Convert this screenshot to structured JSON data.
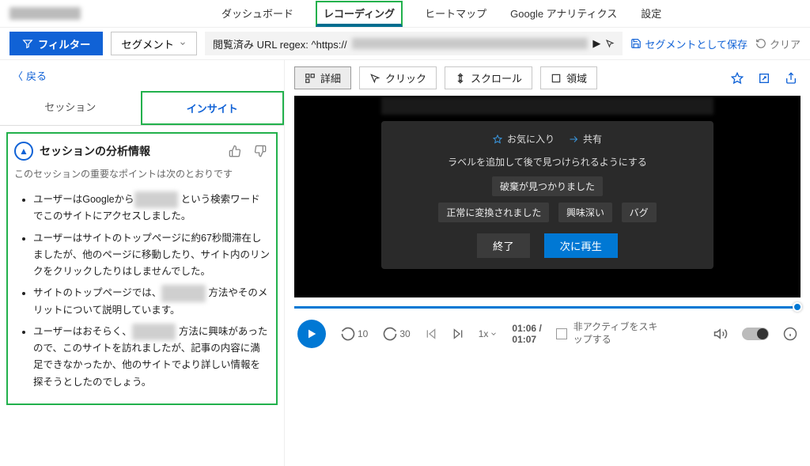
{
  "topnav": {
    "tabs": [
      "ダッシュボード",
      "レコーディング",
      "ヒートマップ",
      "Google アナリティクス",
      "設定"
    ],
    "active_index": 1
  },
  "filterbar": {
    "filter_btn": "フィルター",
    "segment_btn": "セグメント",
    "url_prefix": "閲覧済み URL regex: ^https://",
    "save_segment": "セグメントとして保存",
    "clear": "クリア"
  },
  "left": {
    "back": "戻る",
    "tabs": {
      "session": "セッション",
      "insight": "インサイト"
    },
    "insight": {
      "title": "セッションの分析情報",
      "subtitle": "このセッションの重要なポイントは次のとおりです",
      "items_parts": [
        [
          "ユーザーはGoogleから",
          "BLUR",
          "という検索ワードでこのサイトにアクセスしました。"
        ],
        [
          "ユーザーはサイトのトップページに約67秒間滞在しましたが、他のページに移動したり、サイト内のリンクをクリックしたりはしませんでした。"
        ],
        [
          "サイトのトップページでは、",
          "BLUR",
          "方法やそのメリットについて説明しています。"
        ],
        [
          "ユーザーはおそらく、",
          "BLUR",
          "方法に興味があったので、このサイトを訪れましたが、記事の内容に満足できなかったか、他のサイトでより詳しい情報を探そうとしたのでしょう。"
        ]
      ]
    }
  },
  "right": {
    "toolbar": {
      "detail": "詳細",
      "click": "クリック",
      "scroll": "スクロール",
      "area": "領域"
    },
    "player": {
      "favorite": "お気に入り",
      "share": "共有",
      "label_hint": "ラベルを追加して後で見つけられるようにする",
      "tag1": "破棄が見つかりました",
      "tag2": "正常に変換されました",
      "tag3": "興味深い",
      "tag4": "バグ",
      "end": "終了",
      "next": "次に再生"
    },
    "controls": {
      "rewind": "10",
      "forward": "30",
      "speed": "1x",
      "time_current": "01:06",
      "time_total": "01:07",
      "skip_inactive": "非アクティブをスキップする"
    }
  }
}
